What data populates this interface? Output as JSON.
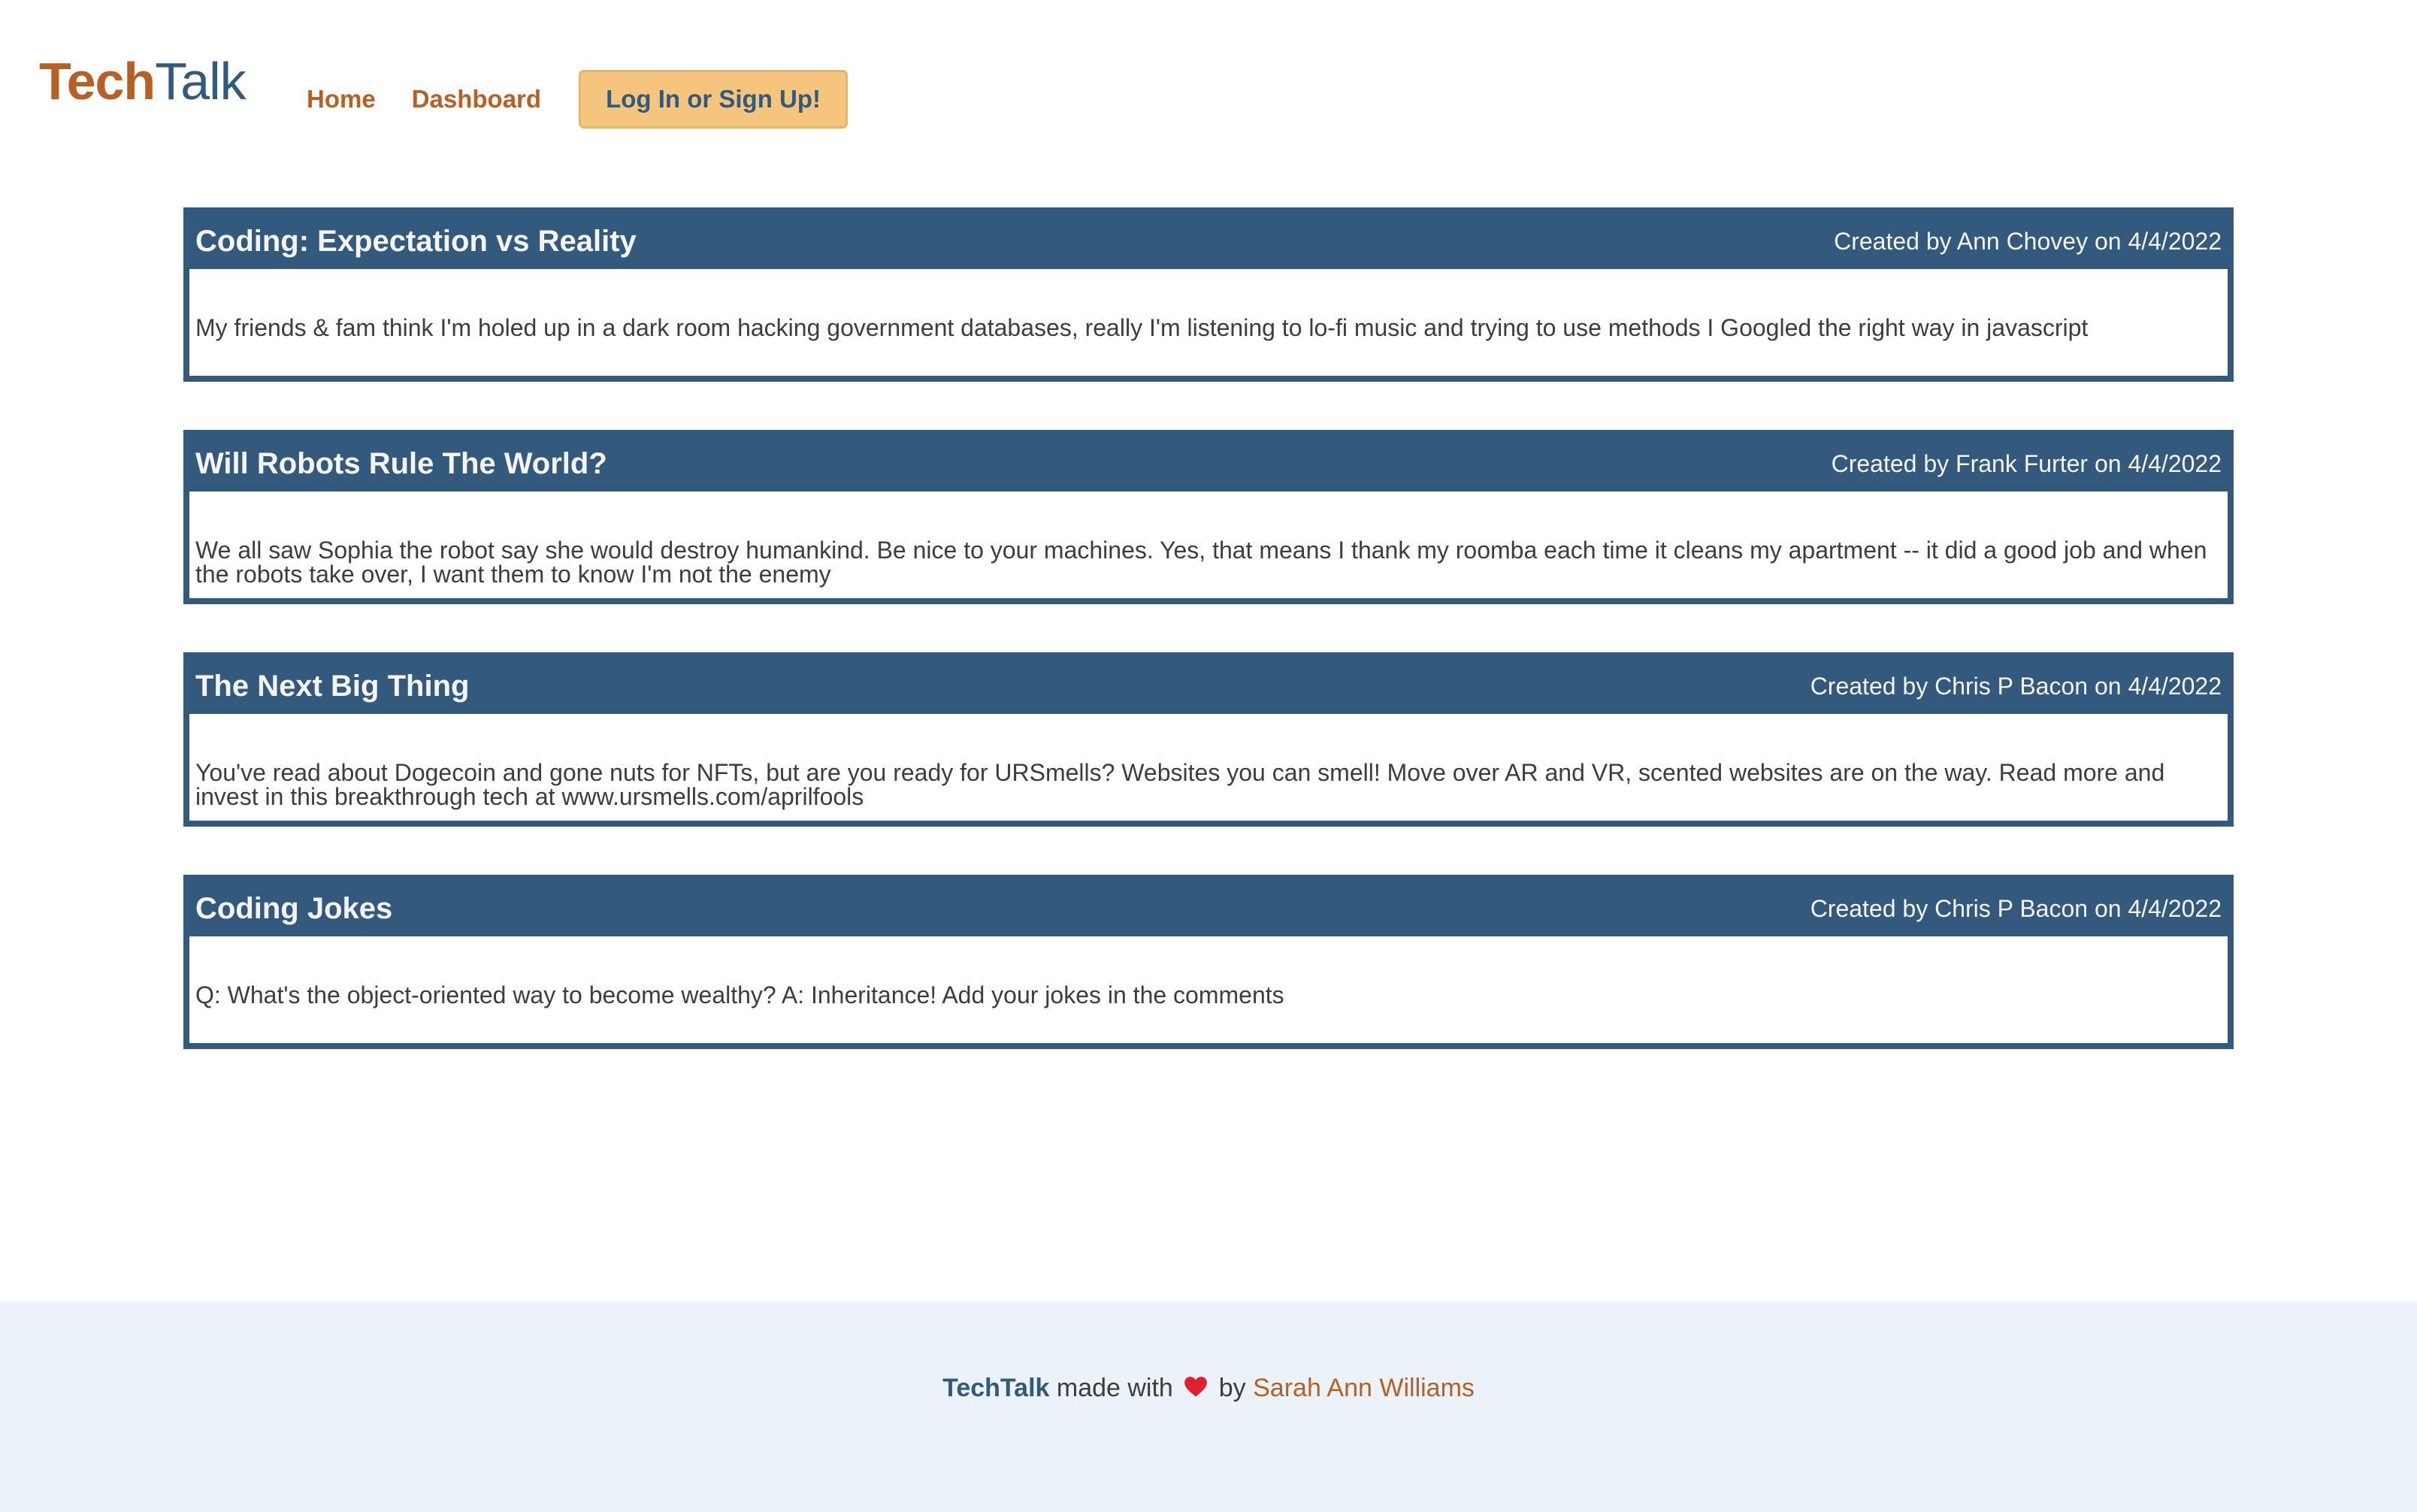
{
  "header": {
    "logo": {
      "part1": "Tech",
      "part2": "Talk"
    },
    "nav": {
      "home": "Home",
      "dashboard": "Dashboard",
      "login": "Log In or Sign Up!"
    }
  },
  "posts": [
    {
      "title": "Coding: Expectation vs Reality",
      "meta": "Created by Ann Chovey on 4/4/2022",
      "body": "My friends & fam think I'm holed up in a dark room hacking government databases, really I'm listening to lo-fi music and trying to use methods I Googled the right way in javascript"
    },
    {
      "title": "Will Robots Rule The World?",
      "meta": "Created by Frank Furter on 4/4/2022",
      "body": "We all saw Sophia the robot say she would destroy humankind. Be nice to your machines. Yes, that means I thank my roomba each time it cleans my apartment -- it did a good job and when the robots take over, I want them to know I'm not the enemy"
    },
    {
      "title": "The Next Big Thing",
      "meta": "Created by Chris P Bacon on 4/4/2022",
      "body": "You've read about Dogecoin and gone nuts for NFTs, but are you ready for URSmells? Websites you can smell! Move over AR and VR, scented websites are on the way. Read more and invest in this breakthrough tech at www.ursmells.com/aprilfools"
    },
    {
      "title": "Coding Jokes",
      "meta": "Created by Chris P Bacon on 4/4/2022",
      "body": "Q: What's the object-oriented way to become wealthy? A: Inheritance! Add your jokes in the comments"
    }
  ],
  "footer": {
    "brand": "TechTalk",
    "made_with": "made with",
    "heart_icon": "heart-icon",
    "by": "by",
    "author": "Sarah Ann Williams"
  },
  "colors": {
    "brand_orange": "#b85f26",
    "brand_blue": "#335a7d",
    "button_bg": "#f5c57d",
    "footer_bg": "#ebf2f9",
    "heart": "#e0202d"
  }
}
